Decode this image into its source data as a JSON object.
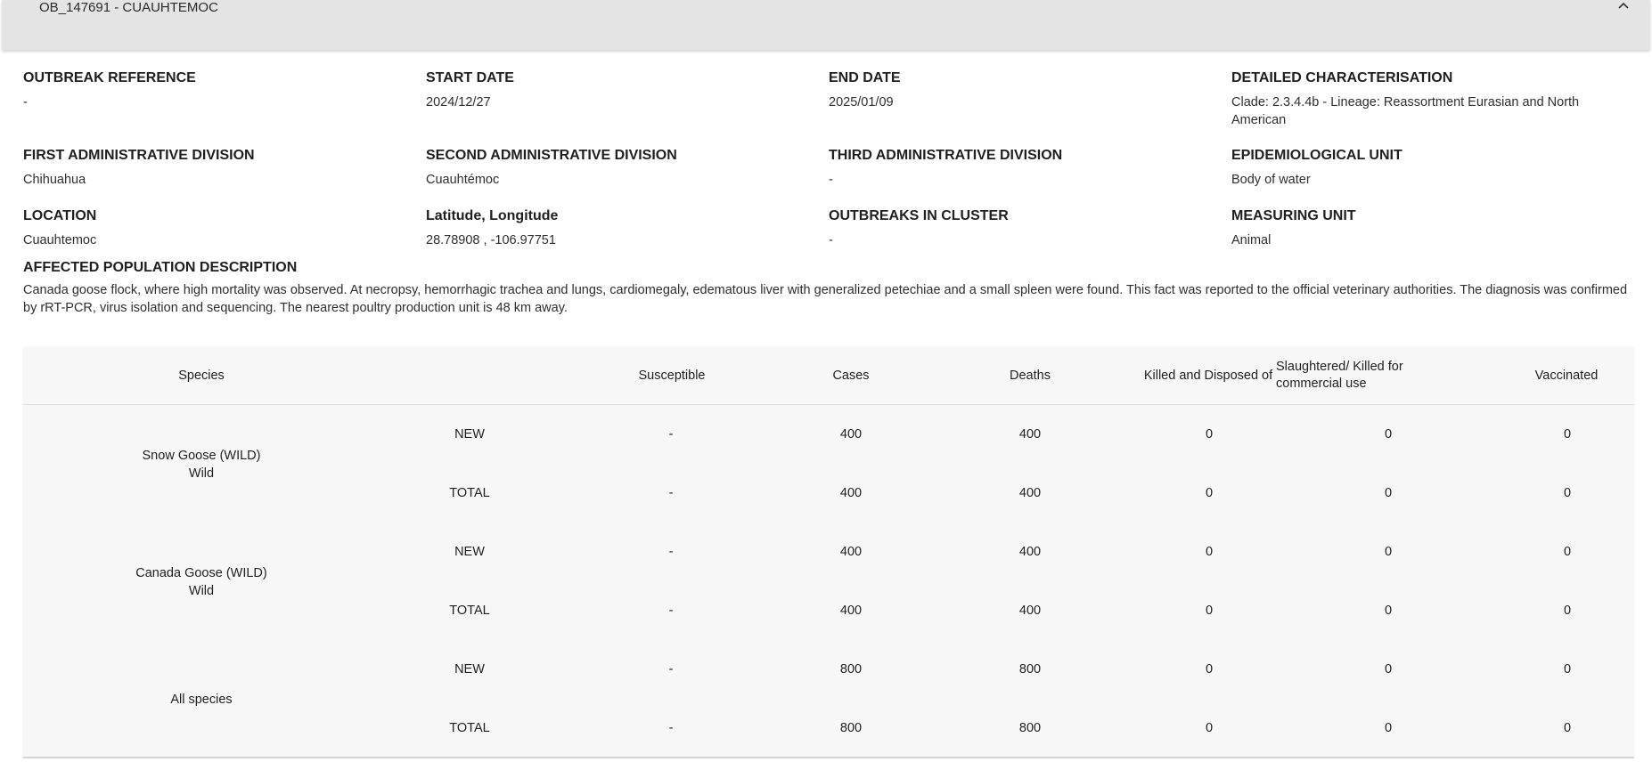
{
  "panel": {
    "title": "OB_147691 - CUAUHTEMOC"
  },
  "details": {
    "outbreak_reference": {
      "label": "OUTBREAK REFERENCE",
      "value": "-"
    },
    "start_date": {
      "label": "START DATE",
      "value": "2024/12/27"
    },
    "end_date": {
      "label": "END DATE",
      "value": "2025/01/09"
    },
    "detailed_characterisation": {
      "label": "DETAILED CHARACTERISATION",
      "value": "Clade: 2.3.4.4b - Lineage: Reassortment Eurasian and North American"
    },
    "first_admin_division": {
      "label": "FIRST ADMINISTRATIVE DIVISION",
      "value": "Chihuahua"
    },
    "second_admin_division": {
      "label": "SECOND ADMINISTRATIVE DIVISION",
      "value": "Cuauhtémoc"
    },
    "third_admin_division": {
      "label": "THIRD ADMINISTRATIVE DIVISION",
      "value": "-"
    },
    "epidemiological_unit": {
      "label": "EPIDEMIOLOGICAL UNIT",
      "value": "Body of water"
    },
    "location": {
      "label": "LOCATION",
      "value": "Cuauhtemoc"
    },
    "lat_long": {
      "label": "Latitude, Longitude",
      "value": "28.78908 , -106.97751"
    },
    "outbreaks_in_cluster": {
      "label": "OUTBREAKS IN CLUSTER",
      "value": "-"
    },
    "measuring_unit": {
      "label": "MEASURING UNIT",
      "value": "Animal"
    }
  },
  "affected_population": {
    "label": "AFFECTED POPULATION DESCRIPTION",
    "text": "Canada goose flock, where high mortality was observed. At necropsy, hemorrhagic trachea and lungs, cardiomegaly, edematous liver with generalized petechiae and a small spleen were found. This fact was reported to the official veterinary authorities. The diagnosis was confirmed by rRT-PCR, virus isolation and sequencing. The nearest poultry production unit is 48 km away."
  },
  "table": {
    "headers": {
      "species": "Species",
      "susceptible": "Susceptible",
      "cases": "Cases",
      "deaths": "Deaths",
      "killed": "Killed and Disposed of",
      "slaughtered": "Slaughtered/ Killed for commercial use",
      "vaccinated": "Vaccinated"
    },
    "groups": [
      {
        "species_line1": "Snow Goose (WILD)",
        "species_line2": "Wild",
        "rows": [
          {
            "type": "NEW",
            "susceptible": "-",
            "cases": "400",
            "deaths": "400",
            "killed": "0",
            "slaughtered": "0",
            "vaccinated": "0"
          },
          {
            "type": "TOTAL",
            "susceptible": "-",
            "cases": "400",
            "deaths": "400",
            "killed": "0",
            "slaughtered": "0",
            "vaccinated": "0"
          }
        ]
      },
      {
        "species_line1": "Canada Goose (WILD)",
        "species_line2": "Wild",
        "rows": [
          {
            "type": "NEW",
            "susceptible": "-",
            "cases": "400",
            "deaths": "400",
            "killed": "0",
            "slaughtered": "0",
            "vaccinated": "0"
          },
          {
            "type": "TOTAL",
            "susceptible": "-",
            "cases": "400",
            "deaths": "400",
            "killed": "0",
            "slaughtered": "0",
            "vaccinated": "0"
          }
        ]
      },
      {
        "species_line1": "All species",
        "species_line2": "",
        "rows": [
          {
            "type": "NEW",
            "susceptible": "-",
            "cases": "800",
            "deaths": "800",
            "killed": "0",
            "slaughtered": "0",
            "vaccinated": "0"
          },
          {
            "type": "TOTAL",
            "susceptible": "-",
            "cases": "800",
            "deaths": "800",
            "killed": "0",
            "slaughtered": "0",
            "vaccinated": "0"
          }
        ]
      }
    ]
  }
}
